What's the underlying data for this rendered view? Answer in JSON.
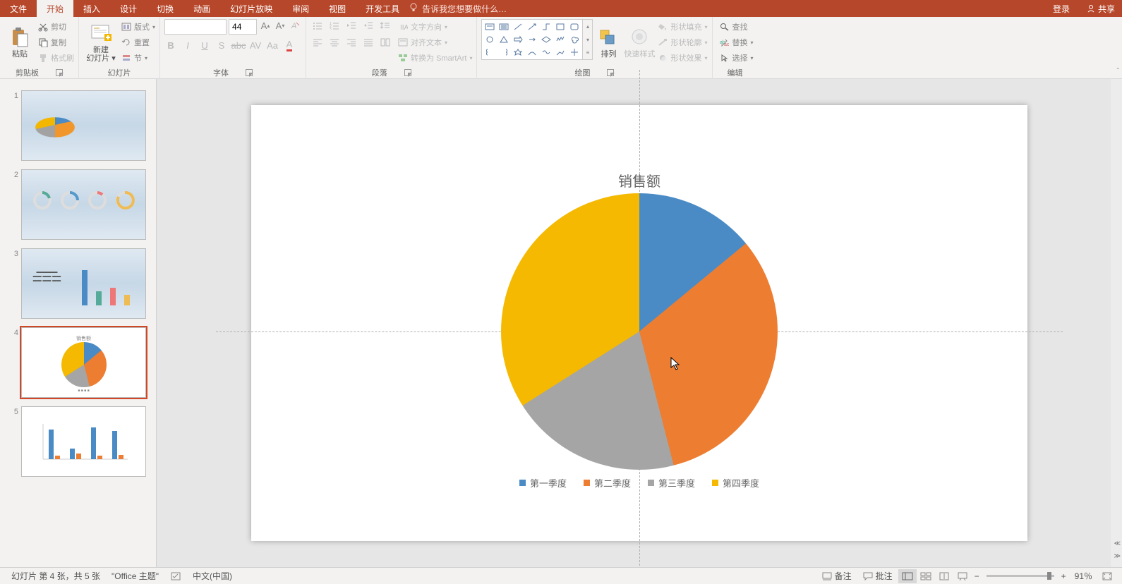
{
  "tabs": {
    "file": "文件",
    "home": "开始",
    "insert": "插入",
    "design": "设计",
    "transitions": "切换",
    "animations": "动画",
    "slideshow": "幻灯片放映",
    "review": "审阅",
    "view": "视图",
    "developer": "开发工具",
    "tell_me_placeholder": "告诉我您想要做什么…"
  },
  "titlebar": {
    "login": "登录",
    "share": "共享"
  },
  "ribbon": {
    "clipboard": {
      "label": "剪贴板",
      "paste": "粘贴",
      "cut": "剪切",
      "copy": "复制",
      "format_painter": "格式刷"
    },
    "slides": {
      "label": "幻灯片",
      "new_slide_l1": "新建",
      "new_slide_l2": "幻灯片",
      "layout": "版式",
      "reset": "重置",
      "section": "节"
    },
    "font": {
      "label": "字体",
      "size_value": "44"
    },
    "paragraph": {
      "label": "段落",
      "text_direction": "文字方向",
      "align_text": "对齐文本",
      "smartart": "转换为 SmartArt"
    },
    "drawing": {
      "label": "绘图",
      "arrange": "排列",
      "quick_styles": "快速样式",
      "shape_fill": "形状填充",
      "shape_outline": "形状轮廓",
      "shape_effects": "形状效果"
    },
    "editing": {
      "label": "编辑",
      "find": "查找",
      "replace": "替换",
      "select": "选择"
    }
  },
  "chart_data": {
    "type": "pie",
    "title": "销售额",
    "categories": [
      "第一季度",
      "第二季度",
      "第三季度",
      "第四季度"
    ],
    "values": [
      14,
      32,
      20,
      34
    ],
    "colors": [
      "#4a8bc6",
      "#ed7d31",
      "#a5a5a5",
      "#f4b900"
    ]
  },
  "thumbnails": {
    "count": 5,
    "selected": 4
  },
  "status": {
    "slide_info": "幻灯片 第 4 张，共 5 张",
    "theme": "\"Office 主题\"",
    "language": "中文(中国)",
    "notes": "备注",
    "comments": "批注",
    "zoom": "91％"
  }
}
